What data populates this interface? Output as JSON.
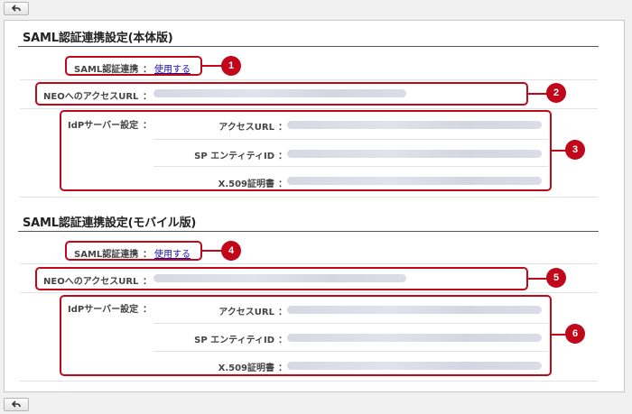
{
  "toolbar": {
    "back_icon": "back-arrow-icon"
  },
  "sections": [
    {
      "title": "SAML認証連携設定(本体版)",
      "saml_label": "SAML認証連携",
      "saml_value": "使用する",
      "neo_label": "NEOへのアクセスURL",
      "idp_label": "IdPサーバー設定",
      "access_url_label": "アクセスURL",
      "entity_label": "SP エンティティID",
      "cert_label": "X.509証明書",
      "sep": "："
    },
    {
      "title": "SAML認証連携設定(モバイル版)",
      "saml_label": "SAML認証連携",
      "saml_value": "使用する",
      "neo_label": "NEOへのアクセスURL",
      "idp_label": "IdPサーバー設定",
      "access_url_label": "アクセスURL",
      "entity_label": "SP エンティティID",
      "cert_label": "X.509証明書",
      "sep": "："
    }
  ],
  "callouts": [
    "1",
    "2",
    "3",
    "4",
    "5",
    "6"
  ],
  "colors": {
    "callout": "#c0081a",
    "link": "#1a0dab"
  }
}
